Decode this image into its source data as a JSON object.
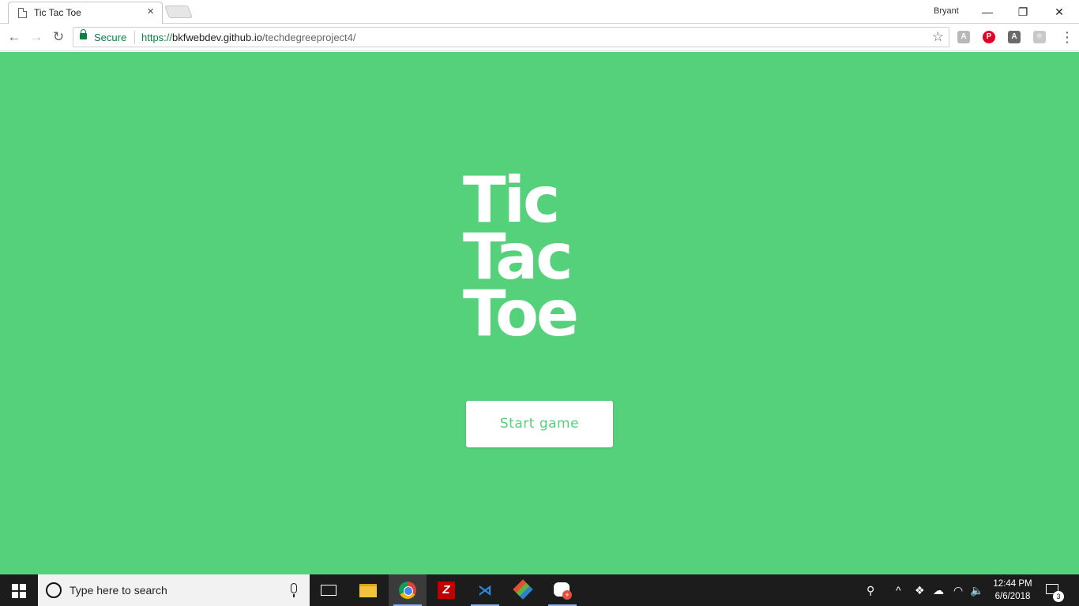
{
  "browser": {
    "tab_title": "Tic Tac Toe",
    "tab_close": "×",
    "profile_name": "Bryant",
    "window_controls": {
      "minimize": "—",
      "restore": "❐",
      "close": "✕"
    },
    "nav": {
      "back": "←",
      "forward": "→",
      "reload": "↻"
    },
    "security_label": "Secure",
    "url": {
      "scheme": "https://",
      "host": "bkfwebdev.github.io",
      "path": "/techdegreeproject4/"
    },
    "bookmark_icon": "☆",
    "extensions": [
      {
        "name": "angular-extension-icon",
        "glyph": "A",
        "color": "#b8b8b8"
      },
      {
        "name": "pinterest-extension-icon",
        "glyph": "P",
        "color": "#e60023"
      },
      {
        "name": "angular-devtools-icon",
        "glyph": "A",
        "color": "#6a6a6a"
      },
      {
        "name": "react-devtools-icon",
        "glyph": "⚛",
        "color": "#c8c8c8"
      }
    ],
    "menu_icon": "⋮"
  },
  "page": {
    "background": "#54d17a",
    "logo_lines": [
      "Tic",
      "Tac",
      "Toe"
    ],
    "start_button": "Start game"
  },
  "taskbar": {
    "search_placeholder": "Type here to search",
    "apps": [
      "task-view",
      "file-explorer",
      "chrome",
      "filezilla",
      "vscode",
      "git",
      "discord"
    ],
    "discord_badge": "+",
    "tray": {
      "people": "⚲",
      "chevron": "^",
      "dropbox": "❖",
      "onedrive": "☁",
      "wifi": "◠",
      "volume": "🔈"
    },
    "time": "12:44 PM",
    "date": "6/6/2018",
    "notification_count": "3"
  }
}
